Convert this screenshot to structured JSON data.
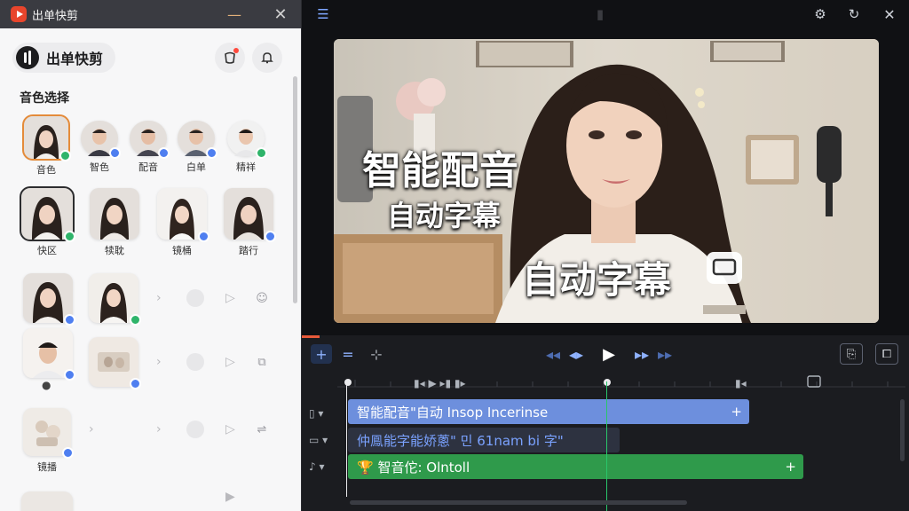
{
  "app": {
    "title": "出单快剪",
    "brand": "出单快剪"
  },
  "titlebar": {
    "minimize": "—",
    "close": "✕"
  },
  "section": {
    "title": "音色选择"
  },
  "voices_row1": [
    {
      "label": "音色",
      "badge": "green"
    },
    {
      "label": "智色",
      "badge": "blue"
    },
    {
      "label": "配音",
      "badge": "blue"
    },
    {
      "label": "白单",
      "badge": "blue"
    },
    {
      "label": "精祥",
      "badge": "green"
    }
  ],
  "voices_row2": [
    {
      "label": "快区",
      "badge": "green"
    },
    {
      "label": "犊耽",
      "badge": ""
    },
    {
      "label": "镜桶",
      "badge": "blue"
    },
    {
      "label": "踏行",
      "badge": "blue"
    }
  ],
  "preview": {
    "caption_main": "智能配音",
    "caption_sub": "自动字幕",
    "caption_big": "自动字幕"
  },
  "timeline": {
    "tracks": [
      {
        "text": "智能配音\"自动 Insop Incerinse",
        "color": "#6d8fdd"
      },
      {
        "text": "仲鳯能字能娇蔥\" 민 61nam bi 字\"",
        "color": "#2d3240",
        "text_color": "#7aa2ff"
      },
      {
        "text": "🏆 智音佗: Olntoll",
        "color": "#2f9a4b"
      }
    ]
  },
  "colors": {
    "accent": "#4f7ff0",
    "green": "#2fb46a",
    "selected_outline": "#e48b3a",
    "playhead": "#29c66b"
  }
}
